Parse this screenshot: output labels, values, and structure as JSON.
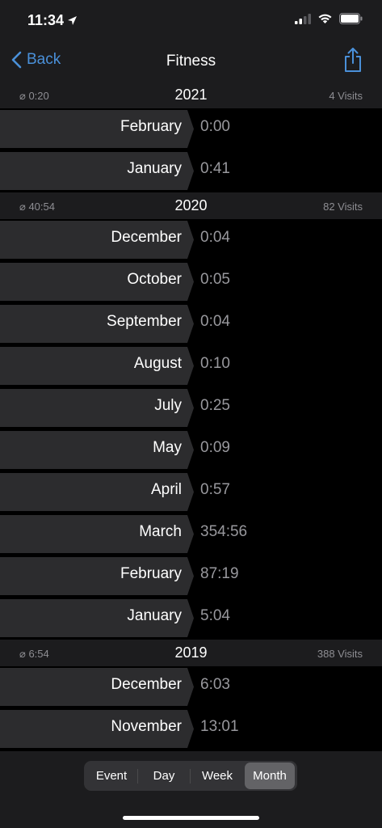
{
  "status_bar": {
    "time": "11:34"
  },
  "nav": {
    "back_label": "Back",
    "title": "Fitness"
  },
  "sections": [
    {
      "avg": "⌀ 0:20",
      "year": "2021",
      "visits": "4 Visits",
      "rows": [
        {
          "month": "February",
          "value": "0:00"
        },
        {
          "month": "January",
          "value": "0:41"
        }
      ]
    },
    {
      "avg": "⌀ 40:54",
      "year": "2020",
      "visits": "82 Visits",
      "rows": [
        {
          "month": "December",
          "value": "0:04"
        },
        {
          "month": "October",
          "value": "0:05"
        },
        {
          "month": "September",
          "value": "0:04"
        },
        {
          "month": "August",
          "value": "0:10"
        },
        {
          "month": "July",
          "value": "0:25"
        },
        {
          "month": "May",
          "value": "0:09"
        },
        {
          "month": "April",
          "value": "0:57"
        },
        {
          "month": "March",
          "value": "354:56"
        },
        {
          "month": "February",
          "value": "87:19"
        },
        {
          "month": "January",
          "value": "5:04"
        }
      ]
    },
    {
      "avg": "⌀ 6:54",
      "year": "2019",
      "visits": "388 Visits",
      "rows": [
        {
          "month": "December",
          "value": "6:03"
        },
        {
          "month": "November",
          "value": "13:01"
        }
      ]
    }
  ],
  "segments": {
    "items": [
      "Event",
      "Day",
      "Week",
      "Month"
    ],
    "selected": "Month"
  },
  "colors": {
    "accent": "#4a90d9",
    "background": "#000000",
    "bar": "#1c1c1e",
    "tag": "#2c2c2e"
  }
}
